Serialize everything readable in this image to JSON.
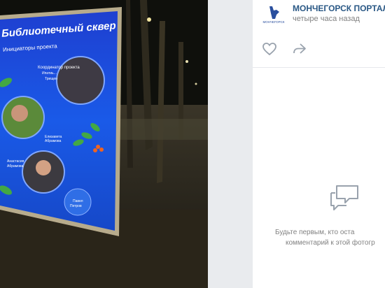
{
  "photo": {
    "poster_title": "Библиотечный сквер",
    "poster_subtitle": "Инициаторы проекта",
    "coordinator": "Координатор проекта",
    "coordinator_sub1": "Ипатиь...",
    "coordinator_sub2": "Трищен",
    "person1": "Елизавета",
    "person1_last": "Абрамова",
    "person2": "Анастасия",
    "person2_last": "Абрамова",
    "person3": "Павел",
    "person3_last": "Петров"
  },
  "post": {
    "author": "МОНЧЕГОРСК ПОРТАЛ",
    "time": "четыре часа назад",
    "logo_text": "МОНЧЕГОРСК"
  },
  "comments": {
    "empty_line1": "Будьте первым, кто оста",
    "empty_line2": "комментарий к этой фотогр"
  },
  "colors": {
    "link": "#2a5885",
    "muted": "#828282",
    "icon": "#99a2ad",
    "poster_blue": "#1a4fd6"
  }
}
